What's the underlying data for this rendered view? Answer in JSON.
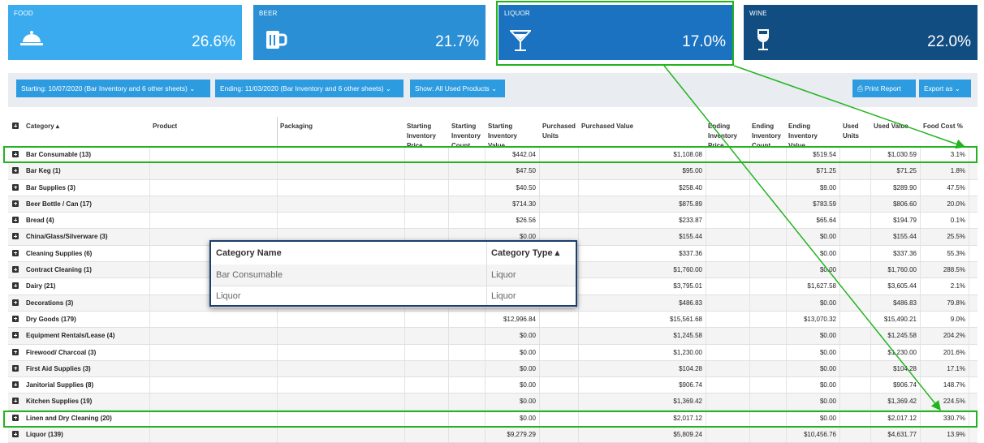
{
  "cards": [
    {
      "label": "FOOD",
      "pct": "26.6%",
      "icon": "food-cloche-icon",
      "color": "#3aabee"
    },
    {
      "label": "BEER",
      "pct": "21.7%",
      "icon": "beer-mug-icon",
      "color": "#2a8fd4"
    },
    {
      "label": "LIQUOR",
      "pct": "17.0%",
      "icon": "cocktail-glass-icon",
      "color": "#1a72c0"
    },
    {
      "label": "WINE",
      "pct": "22.0%",
      "icon": "wine-glass-icon",
      "color": "#124d82"
    }
  ],
  "toolbar": {
    "starting": "Starting: 10/07/2020 (Bar Inventory and 6 other sheets)",
    "ending": "Ending: 11/03/2020 (Bar Inventory and 6 other sheets)",
    "show": "Show: All Used Products",
    "print": "Print Report",
    "export": "Export as"
  },
  "columns": {
    "category": "Category",
    "product": "Product",
    "packaging": "Packaging",
    "start_price": "Starting Inventory Price",
    "start_count": "Starting Inventory Count",
    "start_value": "Starting Inventory Value",
    "purch_units": "Purchased Units",
    "purch_value": "Purchased Value",
    "end_price": "Ending Inventory Price",
    "end_count": "Ending Inventory Count",
    "end_value": "Ending Inventory Value",
    "used_units": "Used Units",
    "used_value": "Used Value",
    "food_cost": "Food Cost %"
  },
  "rows": [
    {
      "category": "Bar Consumable (13)",
      "start_value": "$442.04",
      "purch_value": "$1,108.08",
      "end_value": "$519.54",
      "used_value": "$1,030.59",
      "food_cost": "3.1%"
    },
    {
      "category": "Bar Keg (1)",
      "start_value": "$47.50",
      "purch_value": "$95.00",
      "end_value": "$71.25",
      "used_value": "$71.25",
      "food_cost": "1.8%"
    },
    {
      "category": "Bar Supplies (3)",
      "start_value": "$40.50",
      "purch_value": "$258.40",
      "end_value": "$9.00",
      "used_value": "$289.90",
      "food_cost": "47.5%"
    },
    {
      "category": "Beer Bottle / Can (17)",
      "start_value": "$714.30",
      "purch_value": "$875.89",
      "end_value": "$783.59",
      "used_value": "$806.60",
      "food_cost": "20.0%"
    },
    {
      "category": "Bread (4)",
      "start_value": "$26.56",
      "purch_value": "$233.87",
      "end_value": "$65.64",
      "used_value": "$194.79",
      "food_cost": "0.1%"
    },
    {
      "category": "China/Glass/Silverware (3)",
      "start_value": "$0.00",
      "purch_value": "$155.44",
      "end_value": "$0.00",
      "used_value": "$155.44",
      "food_cost": "25.5%"
    },
    {
      "category": "Cleaning Supplies (6)",
      "start_value": "",
      "purch_value": "$337.36",
      "end_value": "$0.00",
      "used_value": "$337.36",
      "food_cost": "55.3%"
    },
    {
      "category": "Contract Cleaning (1)",
      "start_value": "",
      "purch_value": "$1,760.00",
      "end_value": "$0.00",
      "used_value": "$1,760.00",
      "food_cost": "288.5%"
    },
    {
      "category": "Dairy (21)",
      "start_value": "",
      "purch_value": "$3,795.01",
      "end_value": "$1,627.58",
      "used_value": "$3,605.44",
      "food_cost": "2.1%"
    },
    {
      "category": "Decorations (3)",
      "start_value": "",
      "purch_value": "$486.83",
      "end_value": "$0.00",
      "used_value": "$486.83",
      "food_cost": "79.8%"
    },
    {
      "category": "Dry Goods (179)",
      "start_value": "$12,996.84",
      "purch_value": "$15,561.68",
      "end_value": "$13,070.32",
      "used_value": "$15,490.21",
      "food_cost": "9.0%"
    },
    {
      "category": "Equipment Rentals/Lease (4)",
      "start_value": "$0.00",
      "purch_value": "$1,245.58",
      "end_value": "$0.00",
      "used_value": "$1,245.58",
      "food_cost": "204.2%"
    },
    {
      "category": "Firewood/ Charcoal (3)",
      "start_value": "$0.00",
      "purch_value": "$1,230.00",
      "end_value": "$0.00",
      "used_value": "$1,230.00",
      "food_cost": "201.6%"
    },
    {
      "category": "First Aid Supplies (3)",
      "start_value": "$0.00",
      "purch_value": "$104.28",
      "end_value": "$0.00",
      "used_value": "$104.28",
      "food_cost": "17.1%"
    },
    {
      "category": "Janitorial Supplies (8)",
      "start_value": "$0.00",
      "purch_value": "$906.74",
      "end_value": "$0.00",
      "used_value": "$906.74",
      "food_cost": "148.7%"
    },
    {
      "category": "Kitchen Supplies (19)",
      "start_value": "$0.00",
      "purch_value": "$1,369.42",
      "end_value": "$0.00",
      "used_value": "$1,369.42",
      "food_cost": "224.5%"
    },
    {
      "category": "Linen and Dry Cleaning (20)",
      "start_value": "$0.00",
      "purch_value": "$2,017.12",
      "end_value": "$0.00",
      "used_value": "$2,017.12",
      "food_cost": "330.7%"
    },
    {
      "category": "Liquor (139)",
      "start_value": "$9,279.29",
      "purch_value": "$5,809.24",
      "end_value": "$10,456.76",
      "used_value": "$4,631.77",
      "food_cost": "13.9%"
    }
  ],
  "popup": {
    "col1": "Category Name",
    "col2": "Category Type",
    "rows": [
      {
        "name": "Bar Consumable",
        "type": "Liquor"
      },
      {
        "name": "Liquor",
        "type": "Liquor"
      }
    ]
  },
  "highlight_color": "#22b41f"
}
